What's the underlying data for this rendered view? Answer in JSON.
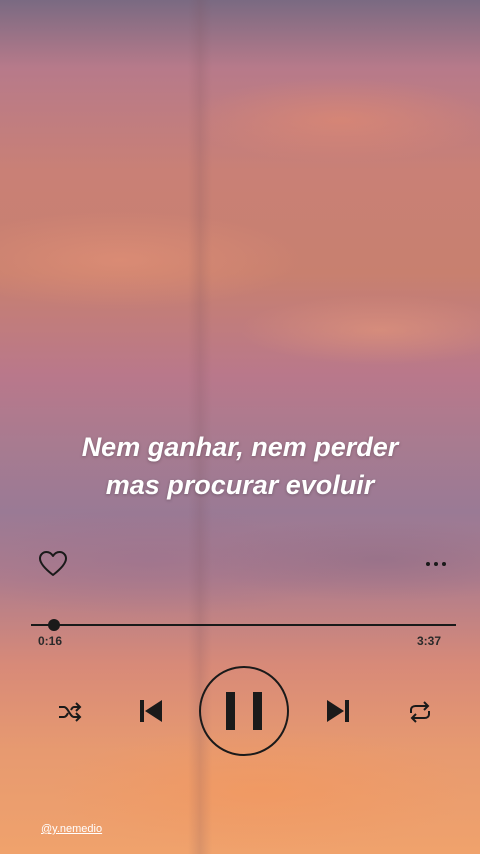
{
  "lyrics": {
    "line1": "Nem ganhar, nem perder",
    "line2": "mas procurar evoluir"
  },
  "player": {
    "elapsed": "0:16",
    "total": "3:37",
    "progress_fraction": 0.055,
    "is_playing": true,
    "liked": false
  },
  "icons": {
    "like": "heart-outline-icon",
    "more": "ellipsis-icon",
    "shuffle": "shuffle-icon",
    "previous": "skip-previous-icon",
    "play_pause": "pause-icon",
    "next": "skip-next-icon",
    "repeat": "repeat-icon"
  },
  "credit": {
    "handle": "@y.nemedio"
  },
  "colors": {
    "controls": "#1a1a1a",
    "lyrics_text": "#ffffff"
  }
}
